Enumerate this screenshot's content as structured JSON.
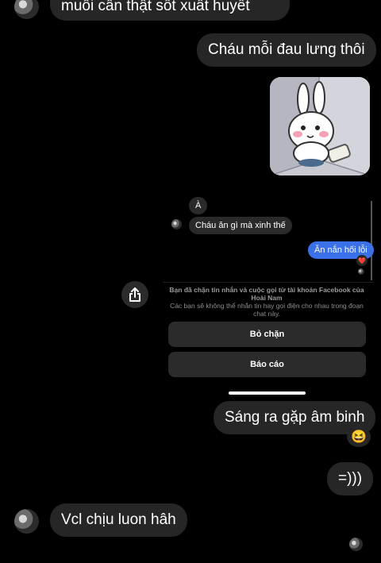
{
  "messages": {
    "m1_in": "muôi cân thật sốt xuất huyết",
    "m2_out": "Cháu mỗi đau lưng thôi",
    "m3_out": "Sáng ra gặp âm binh",
    "m3_reaction": "😆",
    "m4_out": "=)))",
    "m5_in": "Vcl chịu luon hâh"
  },
  "sticker": {
    "icon": "bunny-sticker"
  },
  "embedded_screenshot": {
    "msg_a": "À",
    "msg_b": "Cháu ăn gì mà xinh thế",
    "msg_c": "Ăn nắn hối lỗi",
    "msg_c_reaction": "❤️",
    "notice_title": "Bạn đã chặn tin nhắn và cuộc gọi từ tài khoản Facebook của Hoài Nam",
    "notice_body": "Các bạn sẽ không thể nhắn tin hay gọi điện cho nhau trong đoạn chat này.",
    "unblock_label": "Bỏ chặn",
    "report_label": "Báo cáo"
  },
  "colors": {
    "background": "#000000",
    "bubble": "#262626",
    "sent_blue": "#3a70e8"
  }
}
